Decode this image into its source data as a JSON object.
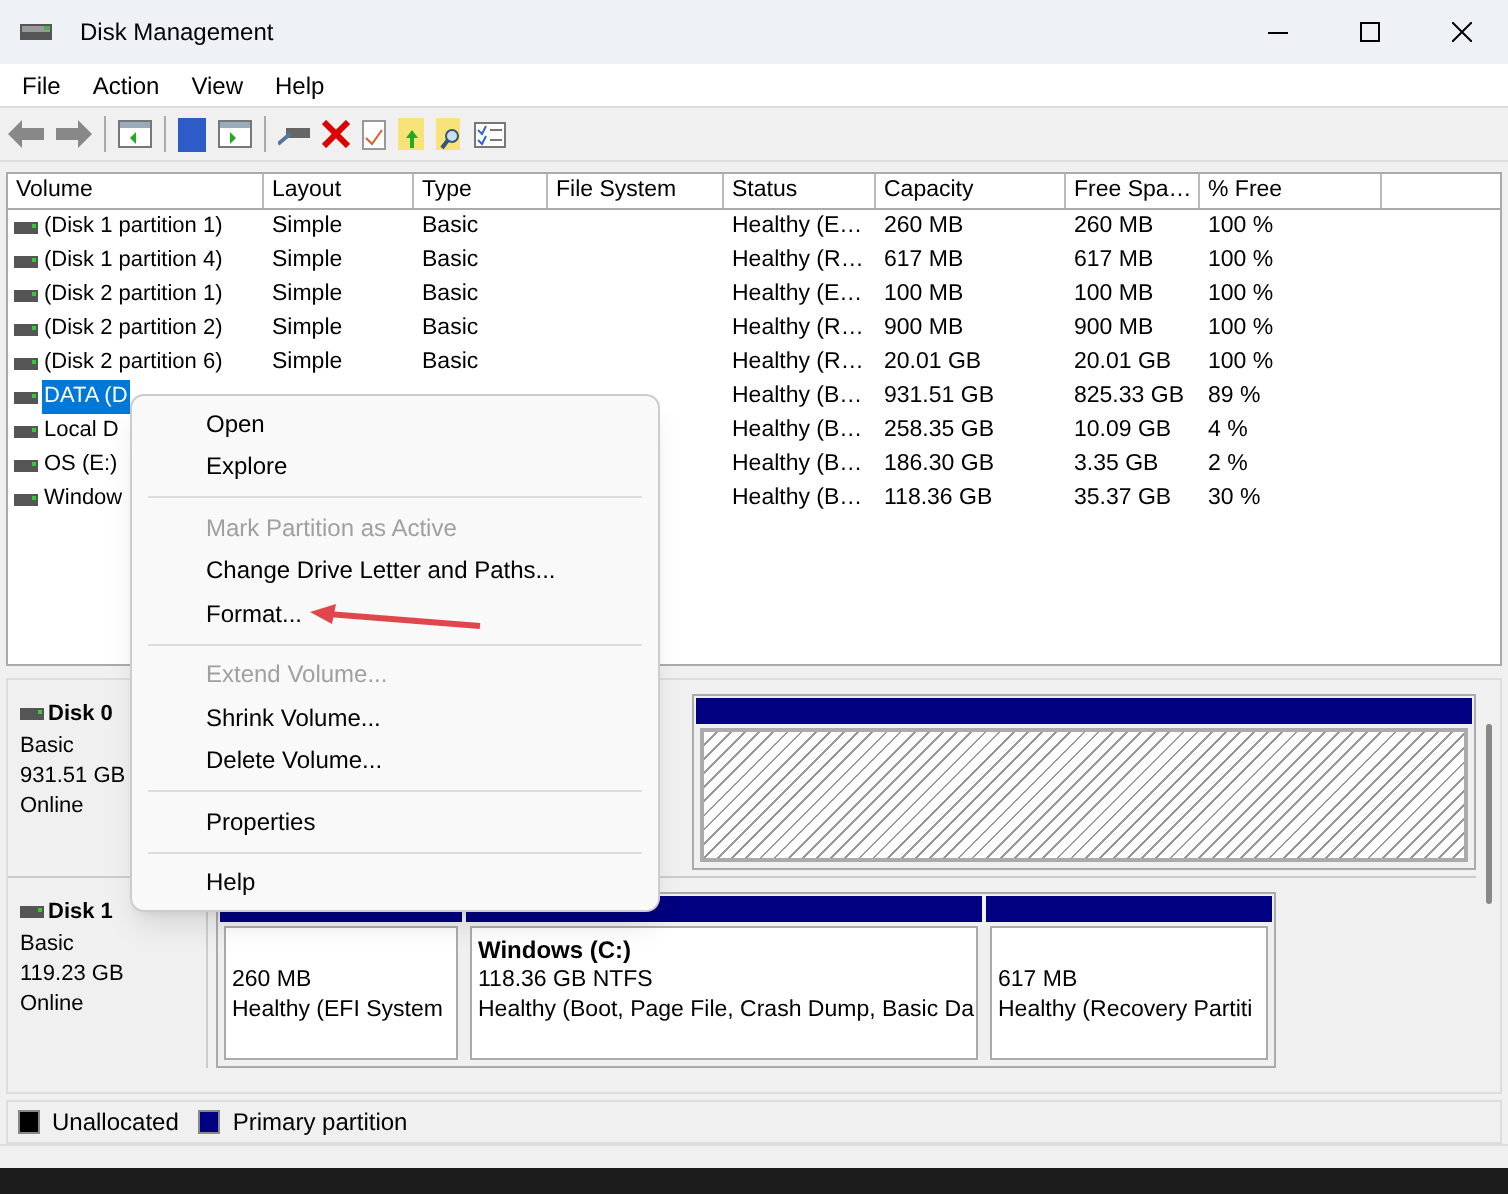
{
  "window": {
    "title": "Disk Management"
  },
  "menu_bar": [
    "File",
    "Action",
    "View",
    "Help"
  ],
  "table": {
    "columns": [
      "Volume",
      "Layout",
      "Type",
      "File System",
      "Status",
      "Capacity",
      "Free Spa…",
      "% Free"
    ],
    "rows": [
      {
        "selected": false,
        "cells": [
          "(Disk 1 partition 1)",
          "Simple",
          "Basic",
          null,
          "Healthy (E…",
          "260 MB",
          "260 MB",
          "100 %"
        ]
      },
      {
        "selected": false,
        "cells": [
          "(Disk 1 partition 4)",
          "Simple",
          "Basic",
          null,
          "Healthy (R…",
          "617 MB",
          "617 MB",
          "100 %"
        ]
      },
      {
        "selected": false,
        "cells": [
          "(Disk 2 partition 1)",
          "Simple",
          "Basic",
          null,
          "Healthy (E…",
          "100 MB",
          "100 MB",
          "100 %"
        ]
      },
      {
        "selected": false,
        "cells": [
          "(Disk 2 partition 2)",
          "Simple",
          "Basic",
          null,
          "Healthy (R…",
          "900 MB",
          "900 MB",
          "100 %"
        ]
      },
      {
        "selected": false,
        "cells": [
          "(Disk 2 partition 6)",
          "Simple",
          "Basic",
          null,
          "Healthy (R…",
          "20.01 GB",
          "20.01 GB",
          "100 %"
        ]
      },
      {
        "selected": true,
        "cells": [
          "DATA (D",
          null,
          null,
          null,
          "Healthy (B…",
          "931.51 GB",
          "825.33 GB",
          "89 %"
        ]
      },
      {
        "selected": false,
        "cells": [
          "Local D",
          null,
          null,
          null,
          "Healthy (B…",
          "258.35 GB",
          "10.09 GB",
          "4 %"
        ]
      },
      {
        "selected": false,
        "cells": [
          "OS (E:)",
          null,
          null,
          null,
          "Healthy (B…",
          "186.30 GB",
          "3.35 GB",
          "2 %"
        ]
      },
      {
        "selected": false,
        "cells": [
          "Window",
          null,
          null,
          null,
          "Healthy (B…",
          "118.36 GB",
          "35.37 GB",
          "30 %"
        ]
      }
    ]
  },
  "disks": [
    {
      "name": "Disk 0",
      "type": "Basic",
      "size": "931.51 GB",
      "status": "Online",
      "partitions": [
        {
          "selected": true
        }
      ]
    },
    {
      "name": "Disk 1",
      "type": "Basic",
      "size": "119.23 GB",
      "status": "Online",
      "partitions": [
        {
          "selected": false,
          "lines": [
            "260 MB",
            "Healthy (EFI System"
          ]
        },
        {
          "selected": false,
          "title": "Windows  (C:)",
          "lines": [
            "118.36 GB NTFS",
            "Healthy (Boot, Page File, Crash Dump, Basic Da"
          ]
        },
        {
          "selected": false,
          "lines": [
            "617 MB",
            "Healthy (Recovery Partiti"
          ]
        }
      ]
    }
  ],
  "legend": [
    {
      "label": "Unallocated",
      "color": "#000000"
    },
    {
      "label": "Primary partition",
      "color": "#000080"
    }
  ],
  "context_menu": [
    {
      "kind": "item",
      "label": "Open",
      "disabled": false
    },
    {
      "kind": "item",
      "label": "Explore",
      "disabled": false
    },
    {
      "kind": "separator"
    },
    {
      "kind": "item",
      "label": "Mark Partition as Active",
      "disabled": true
    },
    {
      "kind": "item",
      "label": "Change Drive Letter and Paths...",
      "disabled": false
    },
    {
      "kind": "item",
      "label": "Format...",
      "disabled": false
    },
    {
      "kind": "separator"
    },
    {
      "kind": "item",
      "label": "Extend Volume...",
      "disabled": true
    },
    {
      "kind": "item",
      "label": "Shrink Volume...",
      "disabled": false
    },
    {
      "kind": "item",
      "label": "Delete Volume...",
      "disabled": false
    },
    {
      "kind": "separator"
    },
    {
      "kind": "item",
      "label": "Properties",
      "disabled": false
    },
    {
      "kind": "separator"
    },
    {
      "kind": "item",
      "label": "Help",
      "disabled": false
    }
  ]
}
